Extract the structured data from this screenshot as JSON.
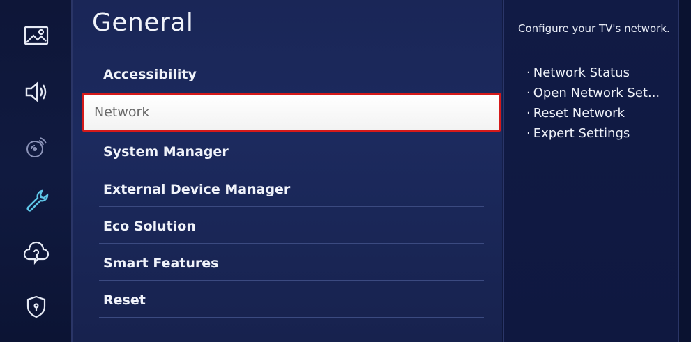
{
  "sidebar": {
    "icons": [
      {
        "name": "picture-icon"
      },
      {
        "name": "sound-icon"
      },
      {
        "name": "broadcasting-icon"
      },
      {
        "name": "general-wrench-icon"
      },
      {
        "name": "support-cloud-icon"
      },
      {
        "name": "privacy-shield-icon"
      }
    ]
  },
  "main": {
    "title": "General",
    "items": [
      {
        "label": "Accessibility"
      },
      {
        "label": "Network",
        "selected": true
      },
      {
        "label": "System Manager"
      },
      {
        "label": "External Device Manager"
      },
      {
        "label": "Eco Solution"
      },
      {
        "label": "Smart Features"
      },
      {
        "label": "Reset"
      }
    ]
  },
  "info": {
    "description": "Configure your TV's network.",
    "bullets": [
      "Network Status",
      "Open Network Set...",
      "Reset Network",
      "Expert Settings"
    ]
  },
  "colors": {
    "background": "#1c2a5e",
    "selected_bg": "#ffffff",
    "selected_border": "#d51a1a"
  }
}
